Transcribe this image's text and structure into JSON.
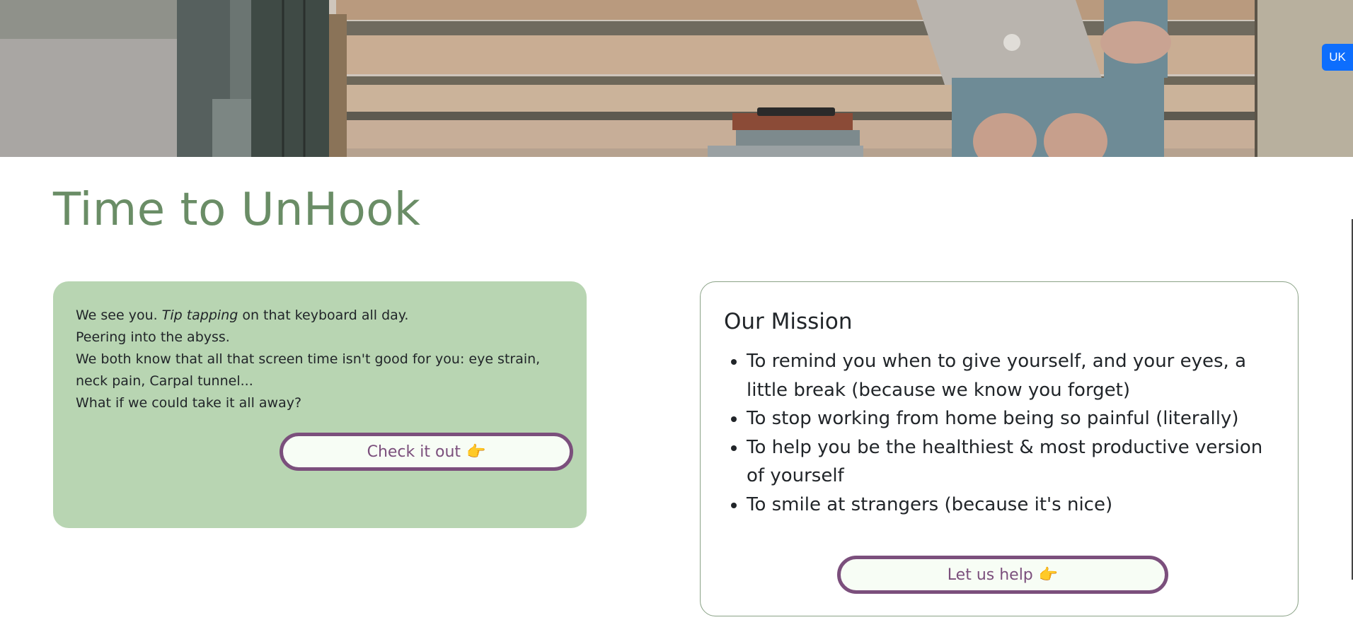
{
  "hero": {
    "alt": ""
  },
  "language_badge": "UK",
  "title": "Time to UnHook",
  "intro": {
    "line1_pre": "We see you. ",
    "line1_em": "Tip tapping",
    "line1_post": " on that keyboard all day.",
    "line2": "Peering into the abyss.",
    "line3": "We both know that all that screen time isn't good for you: eye strain, neck pain, Carpal tunnel...",
    "line4": "What if we could take it all away?",
    "button_label": "Check it out",
    "button_icon": "👉"
  },
  "mission": {
    "heading": "Our Mission",
    "items": [
      "To remind you when to give yourself, and your eyes, a little break (because we know you forget)",
      "To stop working from home being so painful (literally)",
      "To help you be the healthiest & most productive version of yourself",
      "To smile at strangers (because it's nice)"
    ],
    "button_label": "Let us help",
    "button_icon": "👉"
  },
  "colors": {
    "title_green": "#6a8d66",
    "card_green": "#b8d5b2",
    "button_purple": "#7b4f7c",
    "badge_blue": "#0d6efd"
  }
}
